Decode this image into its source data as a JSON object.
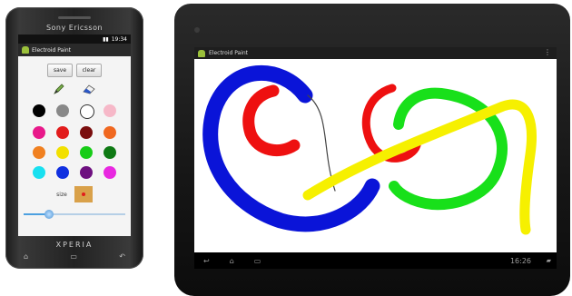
{
  "phone": {
    "brand": "Sony Ericsson",
    "model_logo": "XPERIA",
    "status_time": "19:34",
    "app_title": "Electroid Paint",
    "buttons": {
      "save": "save",
      "clear": "clear"
    },
    "tools": [
      "pen-icon",
      "eraser-icon"
    ],
    "palette": [
      "#000000",
      "#888888",
      "#ffffff",
      "#f6b8c8",
      "#e8198a",
      "#e21c1c",
      "#7a0e0e",
      "#f06820",
      "#f08020",
      "#f2e000",
      "#18cc18",
      "#0f7a14",
      "#18e0f0",
      "#1030e0",
      "#6e1080",
      "#e828e0"
    ],
    "size_label": "size",
    "brush_color": "#e21c1c",
    "brush_size_fraction": 0.25,
    "nav_keys": [
      "home-key-icon",
      "menu-key-icon",
      "back-key-icon"
    ]
  },
  "tablet": {
    "app_title": "Electroid Paint",
    "menu_icon": "overflow-menu-icon",
    "nav_icons": [
      "back-icon",
      "home-icon",
      "recent-apps-icon"
    ],
    "time": "16:26",
    "status_icons": "wifi-icon battery-icon"
  },
  "colors": {
    "stroke_blue": "#0a14d8",
    "stroke_red": "#ee1010",
    "stroke_green": "#18e01a",
    "stroke_yellow": "#f6f000",
    "stroke_thin": "#444444"
  }
}
